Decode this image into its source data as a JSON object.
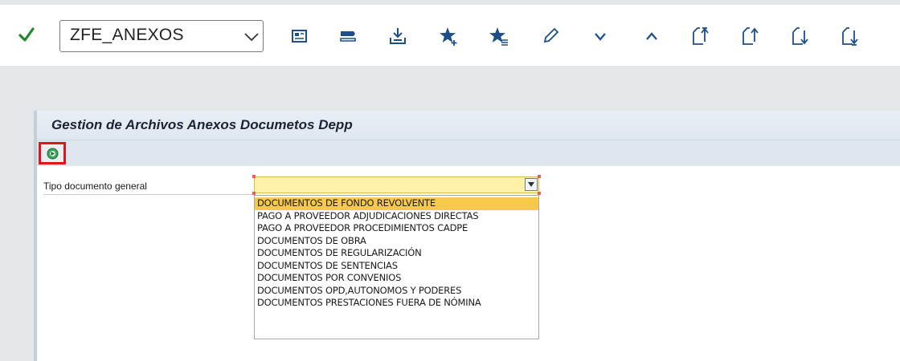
{
  "toolbar": {
    "command_field_value": "ZFE_ANEXOS",
    "icons": [
      "check-icon",
      "chevron-down-icon",
      "display-object-icon",
      "input-arrow-icon",
      "download-tray-icon",
      "add-favorite-icon",
      "favorite-list-icon",
      "edit-pencil-icon",
      "chevron-down-icon",
      "chevron-up-icon",
      "first-page-icon",
      "previous-page-icon",
      "next-page-icon",
      "last-page-icon"
    ]
  },
  "panel": {
    "title": "Gestion de Archivos Anexos Documetos Depp",
    "execute_icon": "execute-icon"
  },
  "form": {
    "label": "Tipo documento general",
    "value": ""
  },
  "dropdown": {
    "options": [
      "DOCUMENTOS DE FONDO REVOLVENTE",
      "PAGO A PROVEEDOR ADJUDICACIONES DIRECTAS",
      "PAGO A PROVEEDOR PROCEDIMIENTOS CADPE",
      "DOCUMENTOS DE OBRA",
      "DOCUMENTOS DE REGULARIZACIÓN",
      "DOCUMENTOS DE SENTENCIAS",
      "DOCUMENTOS POR CONVENIOS",
      "DOCUMENTOS OPD,AUTONOMOS Y PODERES",
      "DOCUMENTOS PRESTACIONES FUERA DE NÓMINA"
    ],
    "selected_index": 0
  },
  "colors": {
    "accent_blue": "#1a4f8a",
    "check_green": "#1e8a2e",
    "selection": "#f7c948",
    "highlight_border": "#e0141e"
  }
}
